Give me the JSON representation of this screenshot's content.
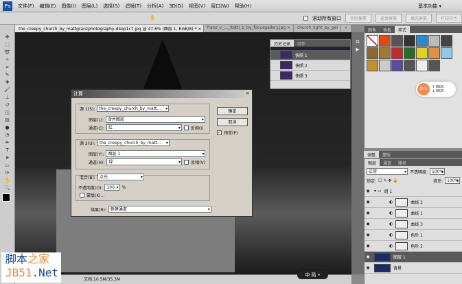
{
  "menu": {
    "logo": "Ps",
    "items": [
      "文件(F)",
      "编辑(E)",
      "图像(I)",
      "图层(L)",
      "选择(S)",
      "滤镜(T)",
      "分析(A)",
      "3D(D)",
      "视图(V)",
      "窗口(W)",
      "帮助(H)"
    ],
    "workspace": "基本功能 ▾"
  },
  "options": {
    "scroll_all": "滚动所有窗口",
    "buttons": [
      "实际像素",
      "适合屏幕",
      "填充屏幕",
      "打印尺寸"
    ]
  },
  "tabs": [
    "the_creepy_church_by_mattgranzphotography-d4op1c7.jpg @ 47.6% (图层 1, RGB/8) * ×",
    "franz_v_..._itotti_b_by_focusgallery.jpg ×",
    "church_light_by_gel",
    "»"
  ],
  "status": {
    "doc": "文档:10.5M/35.3M"
  },
  "styles_panel": {
    "tabs": [
      "颜色",
      "色板",
      "样式"
    ],
    "swatches": [
      "#ffffff",
      "#e04a10",
      "#555555",
      "#333333",
      "#2a8ad0",
      "#bbbbbb",
      "#444444",
      "#8a6a30",
      "#a07a30",
      "#c02a2a",
      "#2a6a2a",
      "#e0d020",
      "#e09040",
      "#90c8e8",
      "#c09030",
      "#cccccc",
      "#5a4aa0",
      "#555555",
      "#eeeeee",
      "#555555"
    ]
  },
  "speed": {
    "percent": "66%",
    "up": "0K/S",
    "down": "0K/S"
  },
  "adjust_tabs": [
    "调整",
    "蒙版"
  ],
  "layers_panel": {
    "tabs": [
      "图层",
      "通道",
      "路径"
    ],
    "blend": "正常",
    "opacity_label": "不透明度:",
    "opacity": "100%",
    "lock_label": "锁定:",
    "fill_label": "填充:",
    "fill": "100%",
    "layers": [
      {
        "name": "组 1",
        "type": "group"
      },
      {
        "name": "曲线 2",
        "type": "adj"
      },
      {
        "name": "曲线 1",
        "type": "adj"
      },
      {
        "name": "曲线 3",
        "type": "adj"
      },
      {
        "name": "色阶 1",
        "type": "adj"
      },
      {
        "name": "色阶 2",
        "type": "adj"
      },
      {
        "name": "图层 1",
        "type": "image",
        "selected": true
      },
      {
        "name": "背景",
        "type": "image"
      }
    ]
  },
  "history": {
    "tabs": [
      "历史记录",
      "动作"
    ],
    "items": [
      "快照 1",
      "快照 2",
      "快照 3"
    ]
  },
  "dialog": {
    "title": "计算",
    "source1": {
      "label": "源 1(S):",
      "file": "the_creepy_church_by_matt...",
      "layer_label": "图层(L):",
      "layer": "合并图层",
      "channel_label": "通道(C):",
      "channel": "红",
      "invert": "反相(I)"
    },
    "source2": {
      "label": "源 2(U):",
      "file": "the_creepy_church_by_matt...",
      "layer_label": "图层(Y):",
      "layer": "图层 1",
      "channel_label": "通道(H):",
      "channel": "绿",
      "invert": "反相(V)"
    },
    "blend_label": "混合(B):",
    "blend": "点光",
    "opacity_label": "不透明度(O):",
    "opacity": "100",
    "pct": "%",
    "mask": "蒙版(K)...",
    "result_label": "结果(R):",
    "result": "新建通道",
    "ok": "确定",
    "cancel": "取消",
    "preview": "预览(P)"
  },
  "watermark": {
    "line1": "脚本之家",
    "line2": "JB51.Net"
  },
  "ime": "中 简 •"
}
